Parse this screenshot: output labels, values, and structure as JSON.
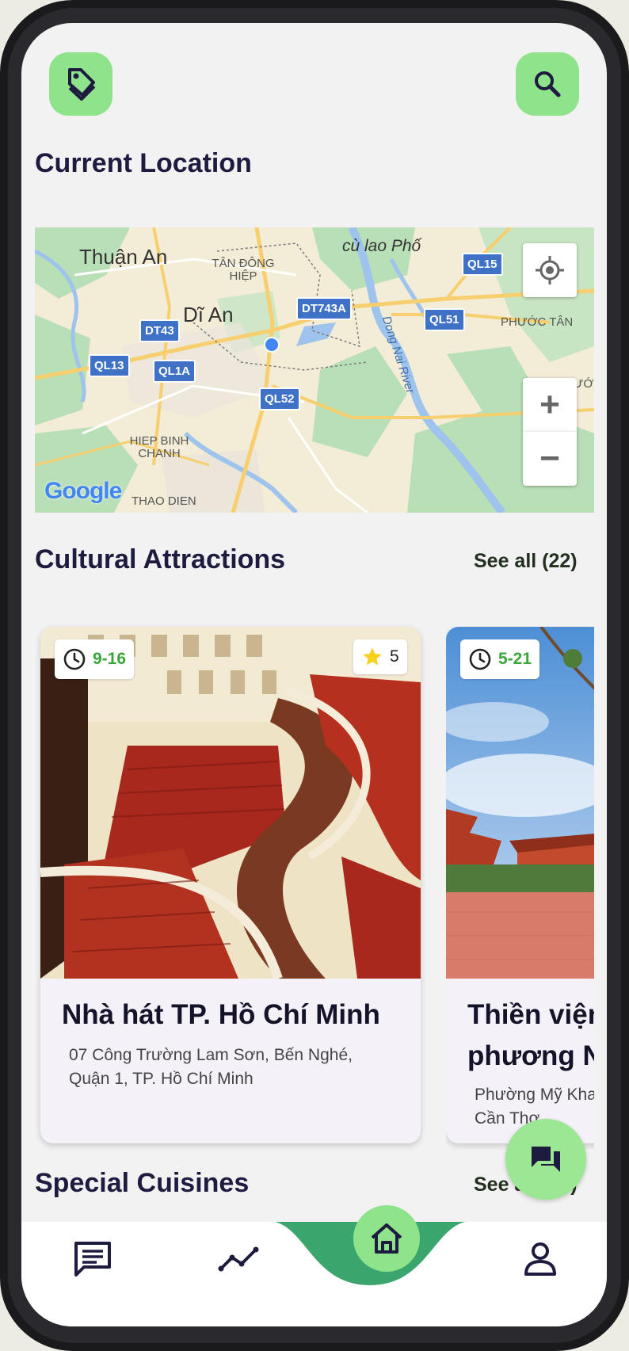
{
  "header": {
    "tag_icon": "tag-icon",
    "search_icon": "search-icon"
  },
  "location": {
    "title": "Current Location",
    "map": {
      "labels": [
        "Thuận An",
        "Dĩ An",
        "cù lao Phố",
        "TÂN ĐÔNG HIỆP",
        "PHƯỚC TÂN",
        "TAM PHƯỚ",
        "HIEP BINH CHANH",
        "THAO DIEN",
        "Dong Nai River"
      ],
      "roads": [
        "QL15",
        "DT743A",
        "QL51",
        "DT43",
        "QL13",
        "QL1A",
        "QL52"
      ],
      "google_logo": "Google",
      "zoom_in": "+",
      "zoom_out": "−"
    }
  },
  "attractions": {
    "title": "Cultural Attractions",
    "see_all": "See all (22)",
    "cards": [
      {
        "hours": "9-16",
        "rating": "5",
        "name": "Nhà hát TP. Hồ Chí Minh",
        "address": "07 Công Trường Lam Sơn, Bến Nghé, Quận 1, TP. Hồ Chí Minh"
      },
      {
        "hours": "5-21",
        "name": "Thiền viện phương N",
        "address": "Phường Mỹ Kha Cần Thơ"
      }
    ]
  },
  "cuisines": {
    "title": "Special Cuisines",
    "see_all": "See all (15)"
  },
  "colors": {
    "accent_green": "#8fe38a",
    "nav_curve_green": "#3aa66e",
    "title_navy": "#1e1b40",
    "hours_green": "#39a53a",
    "star_yellow": "#f7d21c"
  }
}
